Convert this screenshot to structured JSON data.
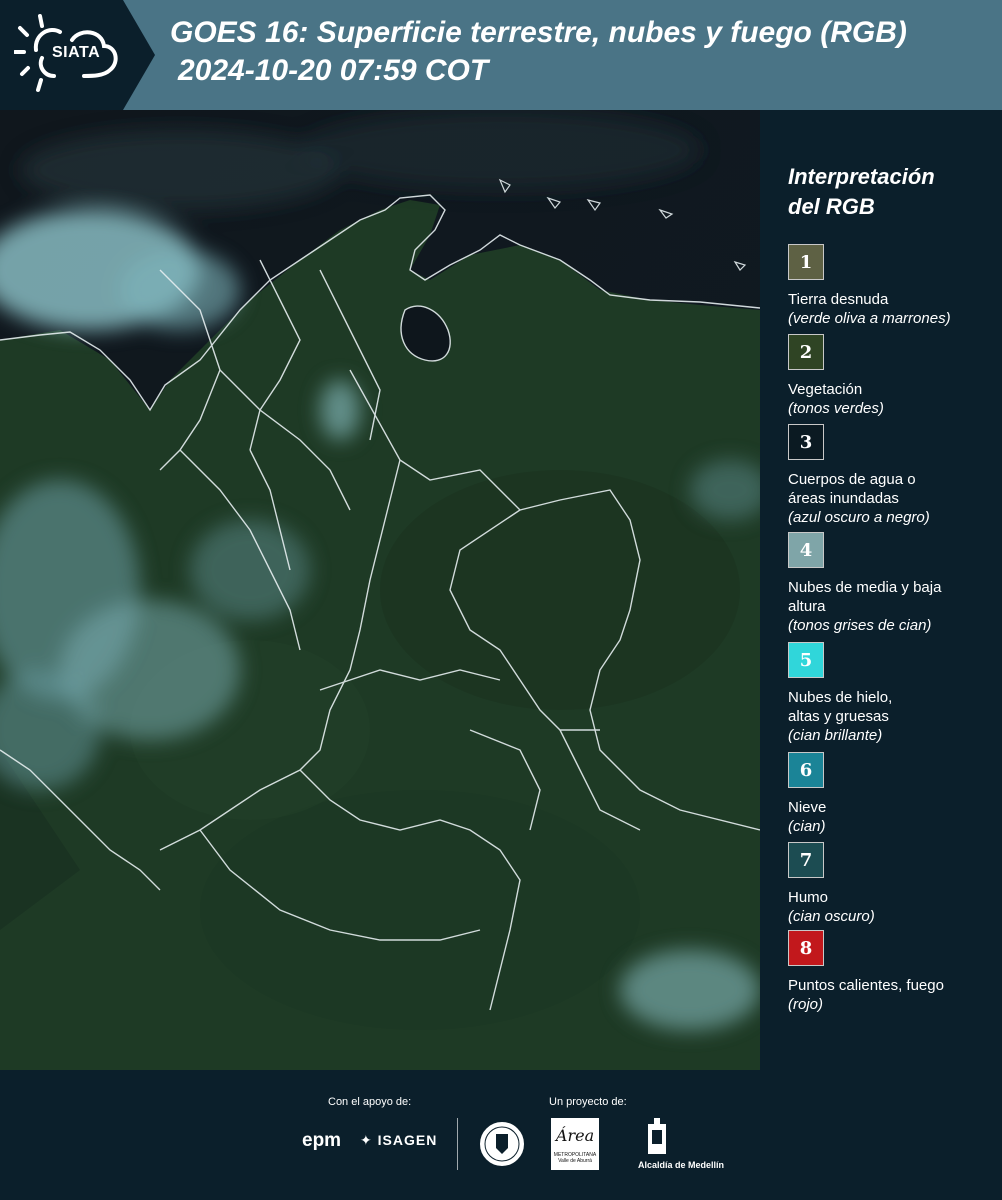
{
  "header": {
    "logo_text": "SIATA",
    "title": "GOES 16: Superficie terrestre, nubes y fuego (RGB)",
    "timestamp": "2024-10-20 07:59 COT"
  },
  "legend": {
    "title_line1": "Interpretación",
    "title_line2": "del RGB",
    "items": [
      {
        "number": "1",
        "color": "#5e6144",
        "label": "Tierra desnuda",
        "desc": "(verde oliva a marrones)"
      },
      {
        "number": "2",
        "color": "#2f4424",
        "label": "Vegetación",
        "desc": "(tonos verdes)"
      },
      {
        "number": "3",
        "color": "#0b1a22",
        "label": "Cuerpos de agua o áreas inundadas",
        "desc": "(azul oscuro a negro)"
      },
      {
        "number": "4",
        "color": "#7fa5a8",
        "label": "Nubes de media y baja altura",
        "desc": "(tonos grises de cian)"
      },
      {
        "number": "5",
        "color": "#30d6da",
        "label": "Nubes de hielo, altas y gruesas",
        "desc": "(cian brillante)"
      },
      {
        "number": "6",
        "color": "#1b8497",
        "label": "Nieve",
        "desc": "(cian)"
      },
      {
        "number": "7",
        "color": "#1c4c52",
        "label": "Humo",
        "desc": "(cian oscuro)"
      },
      {
        "number": "8",
        "color": "#c2181c",
        "label": "Puntos calientes, fuego",
        "desc": "(rojo)"
      }
    ]
  },
  "footer": {
    "support_label": "Con el apoyo de:",
    "project_label": "Un proyecto de:",
    "epm": "epm",
    "isagen": "ISAGEN",
    "area_logo": "Área",
    "area_sub": "METROPOLITANA Valle de Aburrá",
    "alcaldia": "Alcaldía de Medellín"
  },
  "colors": {
    "header_bg": "#4a7486",
    "page_bg": "#0b1f2b",
    "vegetation": "#1e3a24",
    "cloud": "#8fc6cc"
  }
}
